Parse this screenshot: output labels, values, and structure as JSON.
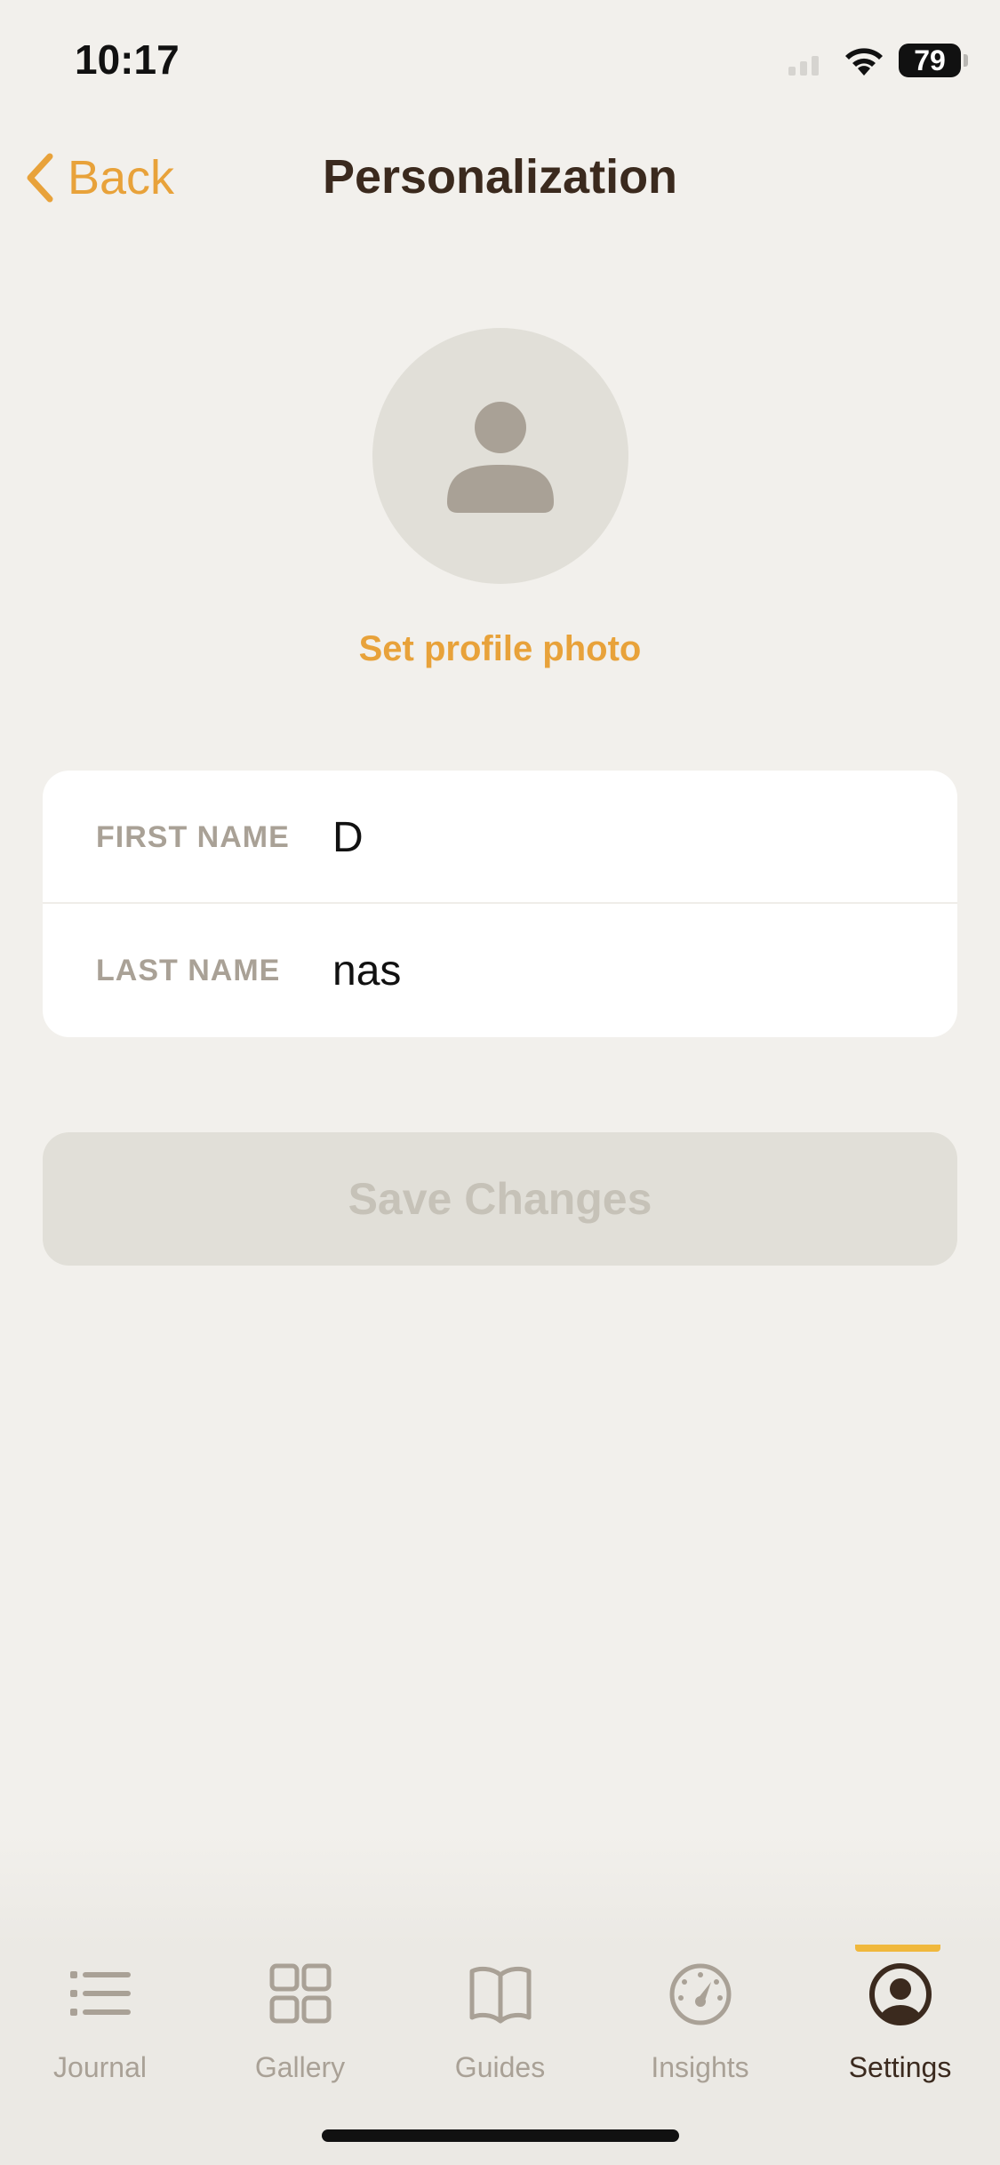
{
  "status_bar": {
    "time": "10:17",
    "battery": "79"
  },
  "nav": {
    "back_label": "Back",
    "title": "Personalization"
  },
  "profile": {
    "avatar_icon": "person-icon",
    "set_photo_label": "Set profile photo"
  },
  "form": {
    "first_name_label": "FIRST NAME",
    "first_name_value": "D",
    "last_name_label": "LAST NAME",
    "last_name_value": "nas"
  },
  "save_button": {
    "label": "Save Changes",
    "enabled": false
  },
  "tab_bar": {
    "active": "Settings",
    "items": [
      {
        "label": "Journal",
        "icon": "list-icon"
      },
      {
        "label": "Gallery",
        "icon": "grid-icon"
      },
      {
        "label": "Guides",
        "icon": "book-icon"
      },
      {
        "label": "Insights",
        "icon": "gauge-icon"
      },
      {
        "label": "Settings",
        "icon": "profile-icon"
      }
    ]
  },
  "colors": {
    "accent": "#e8a23a",
    "background": "#f2f0ec",
    "title": "#3b2a1e",
    "muted": "#a9a196"
  }
}
